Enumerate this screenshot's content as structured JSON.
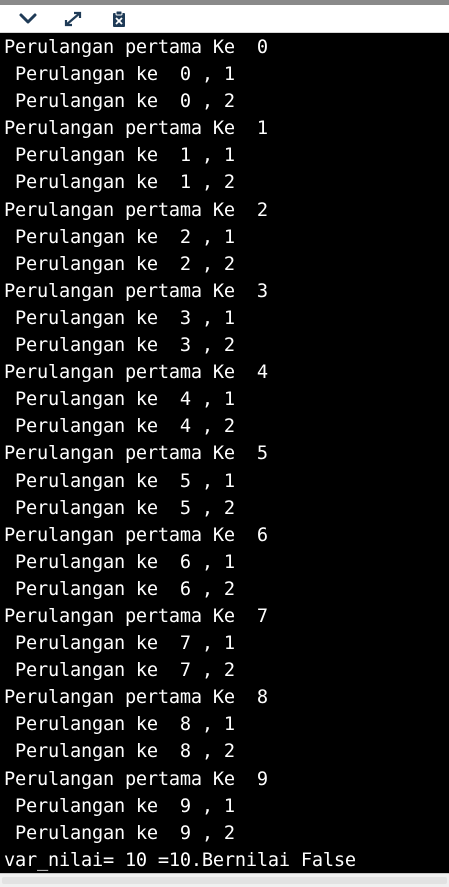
{
  "toolbar": {
    "buttons": [
      {
        "name": "collapse",
        "icon": "chevron-down-icon"
      },
      {
        "name": "expand",
        "icon": "expand-arrows-icon"
      },
      {
        "name": "clear",
        "icon": "clipboard-clear-icon"
      }
    ]
  },
  "console": {
    "background": "#000000",
    "foreground": "#ffffff",
    "lines": [
      "Perulangan pertama Ke  0",
      " Perulangan ke  0 , 1",
      " Perulangan ke  0 , 2",
      "Perulangan pertama Ke  1",
      " Perulangan ke  1 , 1",
      " Perulangan ke  1 , 2",
      "Perulangan pertama Ke  2",
      " Perulangan ke  2 , 1",
      " Perulangan ke  2 , 2",
      "Perulangan pertama Ke  3",
      " Perulangan ke  3 , 1",
      " Perulangan ke  3 , 2",
      "Perulangan pertama Ke  4",
      " Perulangan ke  4 , 1",
      " Perulangan ke  4 , 2",
      "Perulangan pertama Ke  5",
      " Perulangan ke  5 , 1",
      " Perulangan ke  5 , 2",
      "Perulangan pertama Ke  6",
      " Perulangan ke  6 , 1",
      " Perulangan ke  6 , 2",
      "Perulangan pertama Ke  7",
      " Perulangan ke  7 , 1",
      " Perulangan ke  7 , 2",
      "Perulangan pertama Ke  8",
      " Perulangan ke  8 , 1",
      " Perulangan ke  8 , 2",
      "Perulangan pertama Ke  9",
      " Perulangan ke  9 , 1",
      " Perulangan ke  9 , 2",
      "var_nilai= 10 =10.Bernilai False"
    ]
  }
}
